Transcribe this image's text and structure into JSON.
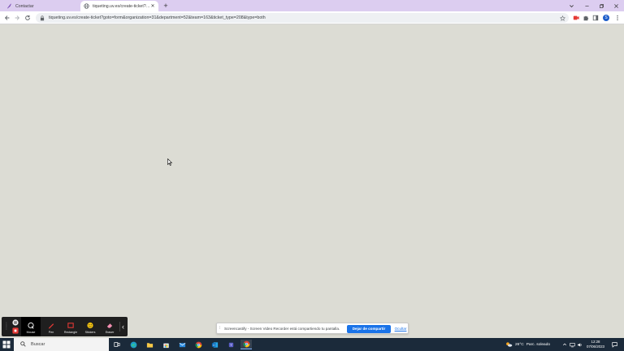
{
  "browser": {
    "tabs": [
      {
        "title": "Contactar",
        "favicon": "feather-icon",
        "active": false
      },
      {
        "title": "tiqueting.uv.es/create-ticket?goto",
        "favicon": "globe-icon",
        "active": true
      }
    ],
    "new_tab_label": "+",
    "window_controls": [
      "chevron-down-icon",
      "minimize-icon",
      "restore-icon",
      "close-icon"
    ],
    "address_bar": {
      "url": "tiqueting.uv.es/create-ticket?goto=form&organization=31&department=52&team=163&ticket_type=208&type=both"
    },
    "profile_initial": "S"
  },
  "screencastify": {
    "tools": [
      {
        "label": "Mouse",
        "icon": "mouse-icon",
        "selected": true
      },
      {
        "label": "Pen",
        "icon": "pen-icon",
        "selected": false
      },
      {
        "label": "Rectangle",
        "icon": "rectangle-icon",
        "selected": false
      },
      {
        "label": "Stickers",
        "icon": "sticker-icon",
        "selected": false
      },
      {
        "label": "Eraser",
        "icon": "eraser-icon",
        "selected": false
      }
    ]
  },
  "share_bar": {
    "message": "Screencastify - Screen Video Recorder está compartiendo tu pantalla.",
    "stop_label": "Dejar de compartir",
    "hide_label": "Ocultar"
  },
  "taskbar": {
    "search_placeholder": "Buscar",
    "weather": {
      "temp": "26°C",
      "desc": "Parc. soleado"
    },
    "time": "12:28",
    "date": "07/06/2023"
  },
  "colors": {
    "tabstrip": "#dccdf0",
    "page_background": "#dcdcd4",
    "accent": "#1a73e8",
    "taskbar": "#1b2a3a"
  }
}
